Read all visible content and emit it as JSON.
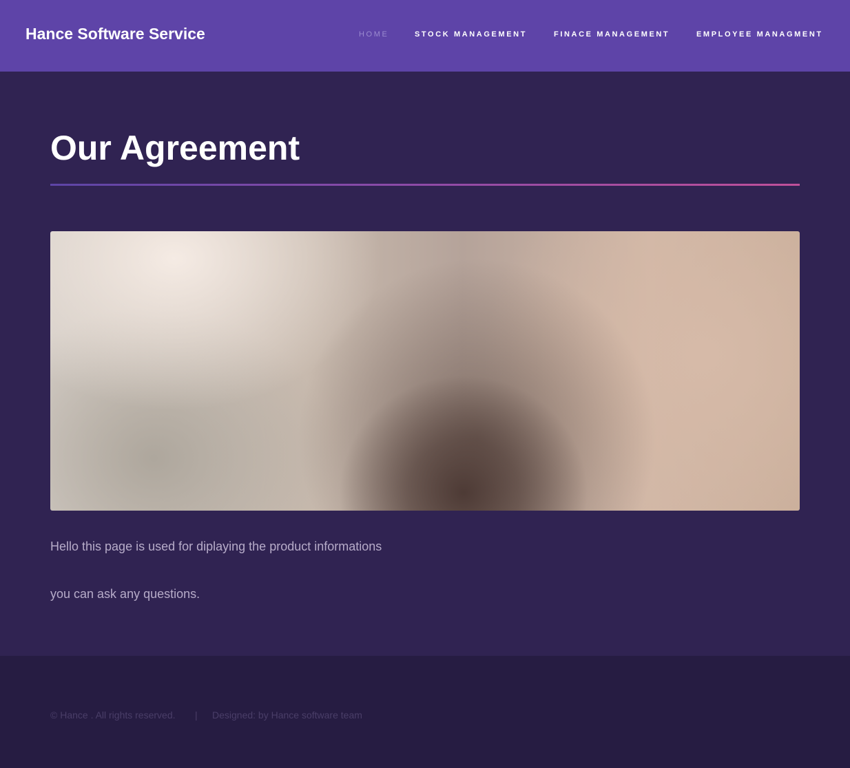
{
  "navbar": {
    "brand": "Hance Software Service",
    "links": [
      {
        "label": "HOME",
        "active": true
      },
      {
        "label": "STOCK MANAGEMENT",
        "active": false
      },
      {
        "label": "FINACE MANAGEMENT",
        "active": false
      },
      {
        "label": "EMPLOYEE MANAGMENT",
        "active": false
      }
    ]
  },
  "main": {
    "title": "Our Agreement",
    "paragraphs": [
      "Hello this page is used for diplaying the product informations",
      "you can ask any questions."
    ]
  },
  "footer": {
    "copyright": "© Hance . All rights reserved.",
    "separator": "|",
    "credit": "Designed: by Hance software team"
  },
  "colors": {
    "navbar_bg": "#5e44a8",
    "main_bg": "#302352",
    "footer_bg": "#261c42",
    "divider_gradient_start": "#5d45a6",
    "divider_gradient_end": "#c0509a"
  }
}
